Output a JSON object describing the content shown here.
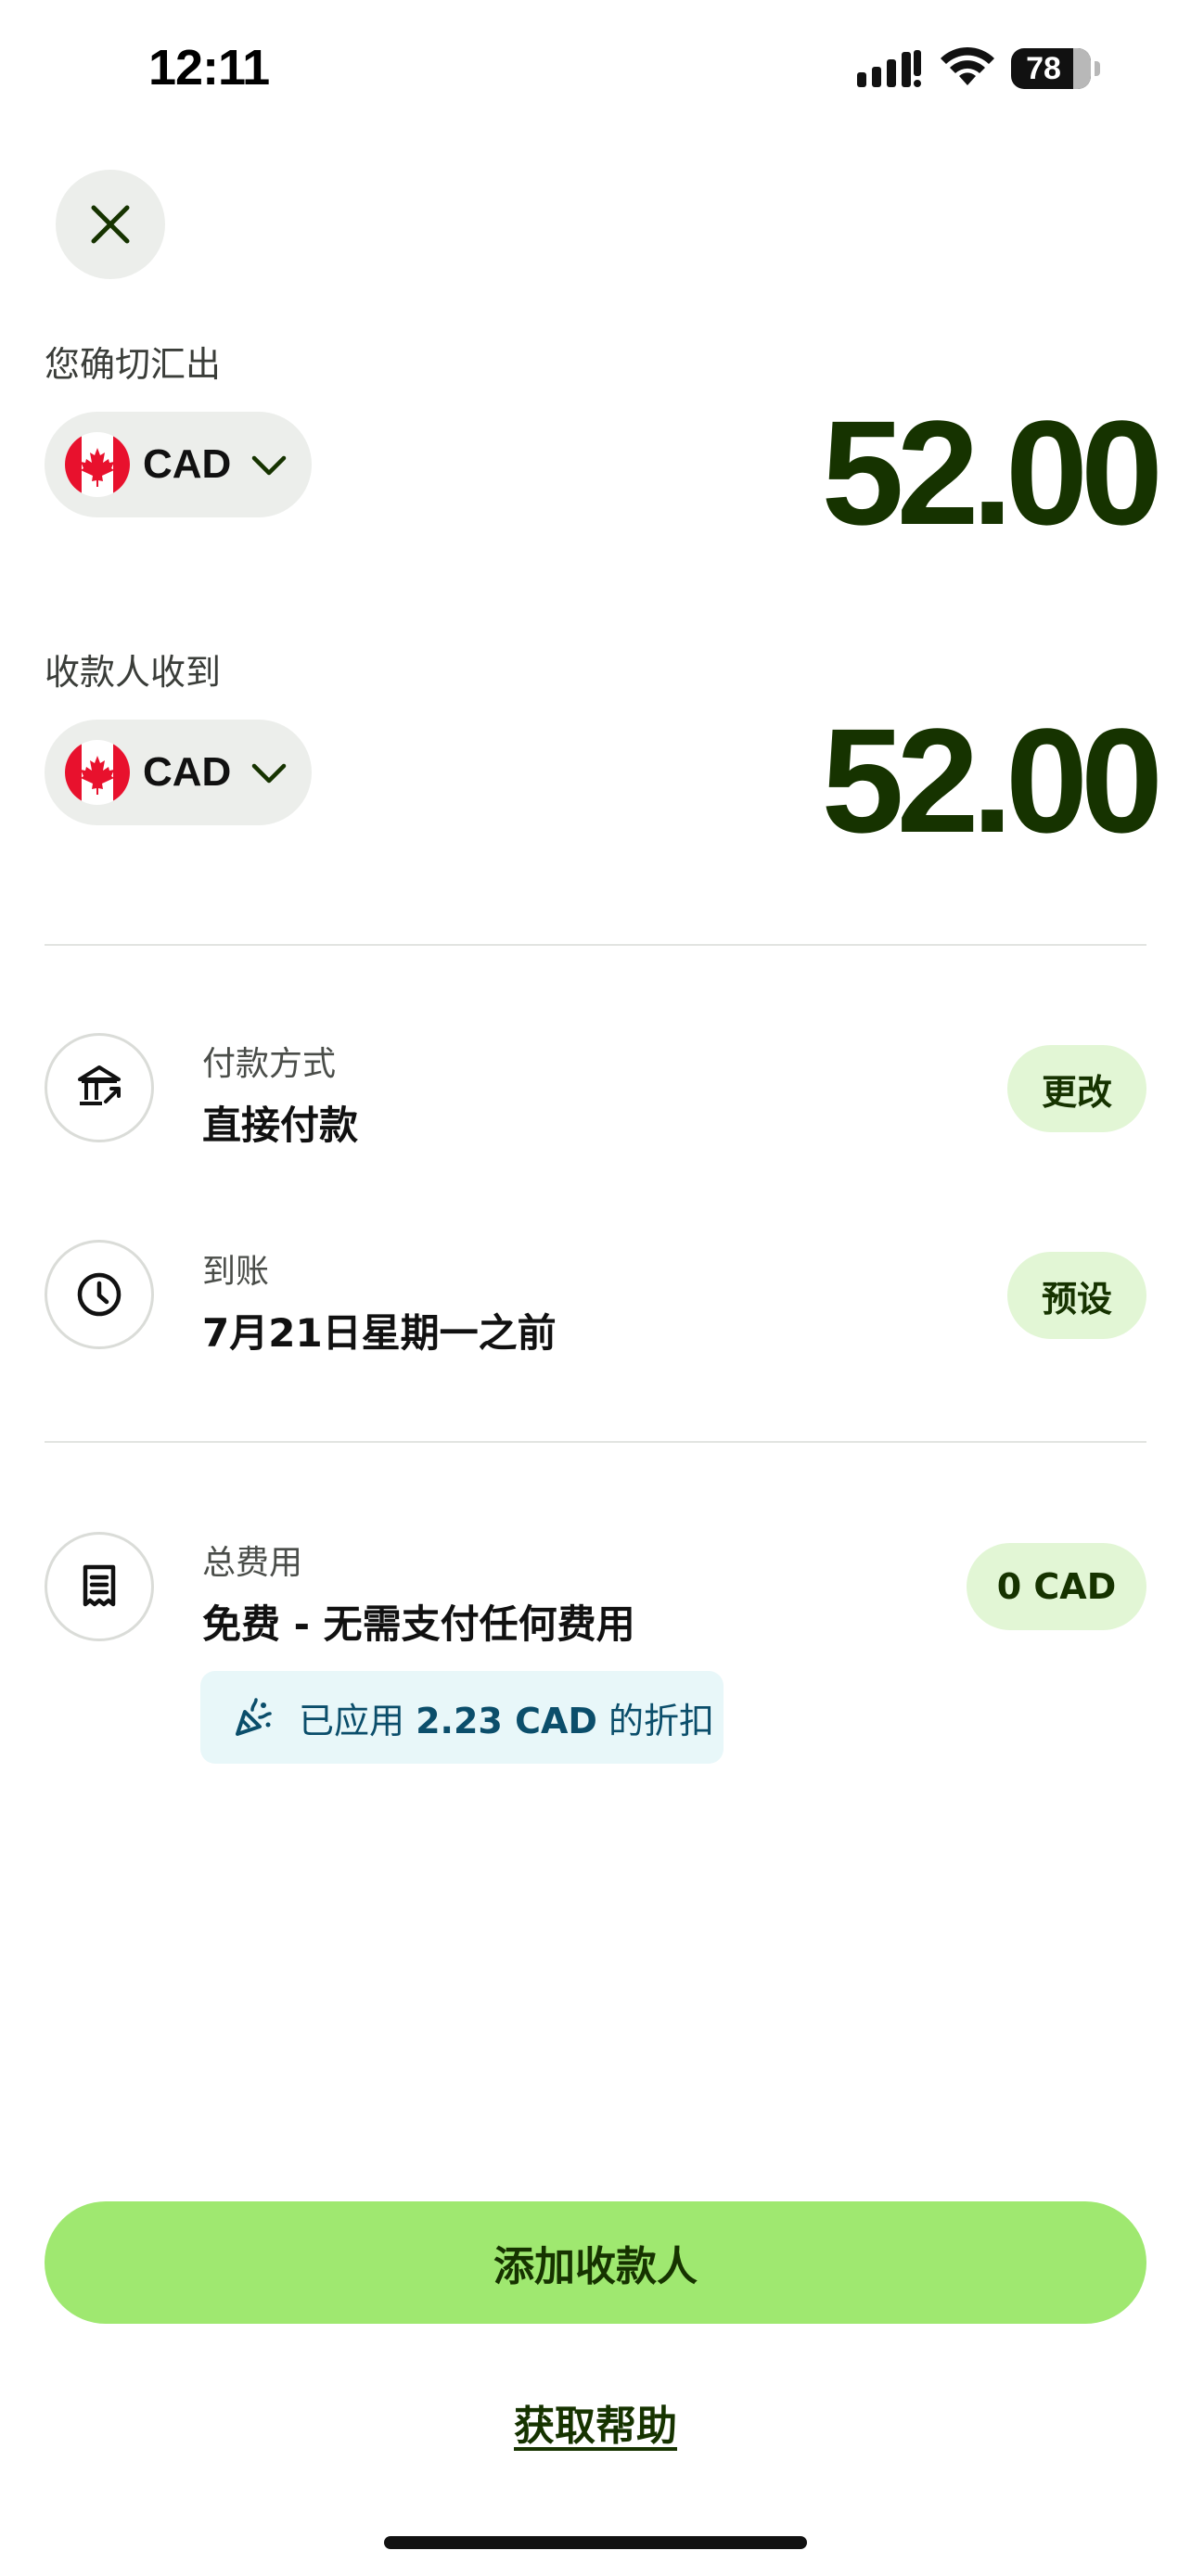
{
  "status_bar": {
    "time": "12:11",
    "battery": "78"
  },
  "send": {
    "label": "您确切汇出",
    "currency": "CAD",
    "amount": "52.00"
  },
  "receive": {
    "label": "收款人收到",
    "currency": "CAD",
    "amount": "52.00"
  },
  "payment_method": {
    "label": "付款方式",
    "value": "直接付款",
    "action": "更改",
    "icon": "bank-icon"
  },
  "arrival": {
    "label": "到账",
    "value": "7月21日星期一之前",
    "action": "预设",
    "icon": "clock-icon"
  },
  "fees": {
    "label": "总费用",
    "value": "免费 - 无需支付任何费用",
    "amount": "0 CAD",
    "icon": "receipt-icon",
    "discount_prefix": "已应用",
    "discount_amount": "2.23 CAD",
    "discount_suffix": "的折扣"
  },
  "actions": {
    "primary": "添加收款人",
    "help": "获取帮助"
  },
  "colors": {
    "brand_green": "#9fe870",
    "dark_green": "#163300",
    "pill_green": "#e2f6d5",
    "discount_bg": "#e8f7f9",
    "discount_text": "#0b4e6b"
  }
}
